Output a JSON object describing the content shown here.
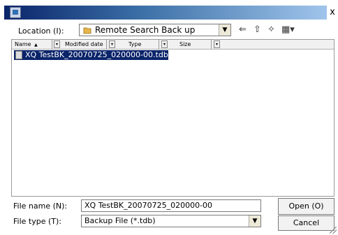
{
  "titlebar": {
    "close_glyph": "x",
    "icon": "app-icon"
  },
  "location": {
    "label": "Location (I):",
    "value": "Remote Search Back up",
    "icon": "folder-icon"
  },
  "toolbar": {
    "back": "⇐",
    "up": "⇧",
    "new_folder": "✧",
    "view": "▦▾"
  },
  "columns": [
    {
      "label": "Name",
      "sort_glyph": "▲"
    },
    {
      "label": "Modified date"
    },
    {
      "label": "Type"
    },
    {
      "label": "Size"
    }
  ],
  "files": [
    {
      "name": "XQ TestBK_20070725_020000-00.tdb",
      "selected": true
    }
  ],
  "filename": {
    "label": "File name (N):",
    "value": "XQ TestBK_20070725_020000-00"
  },
  "filetype": {
    "label": "File type  (T):",
    "value": "Backup File (*.tdb)"
  },
  "buttons": {
    "open": "Open (O)",
    "cancel": "Cancel"
  },
  "colors": {
    "titlebar_start": "#0a246a",
    "titlebar_end": "#a6caf0",
    "selection": "#0a246a",
    "folder": "#e7b64a"
  }
}
